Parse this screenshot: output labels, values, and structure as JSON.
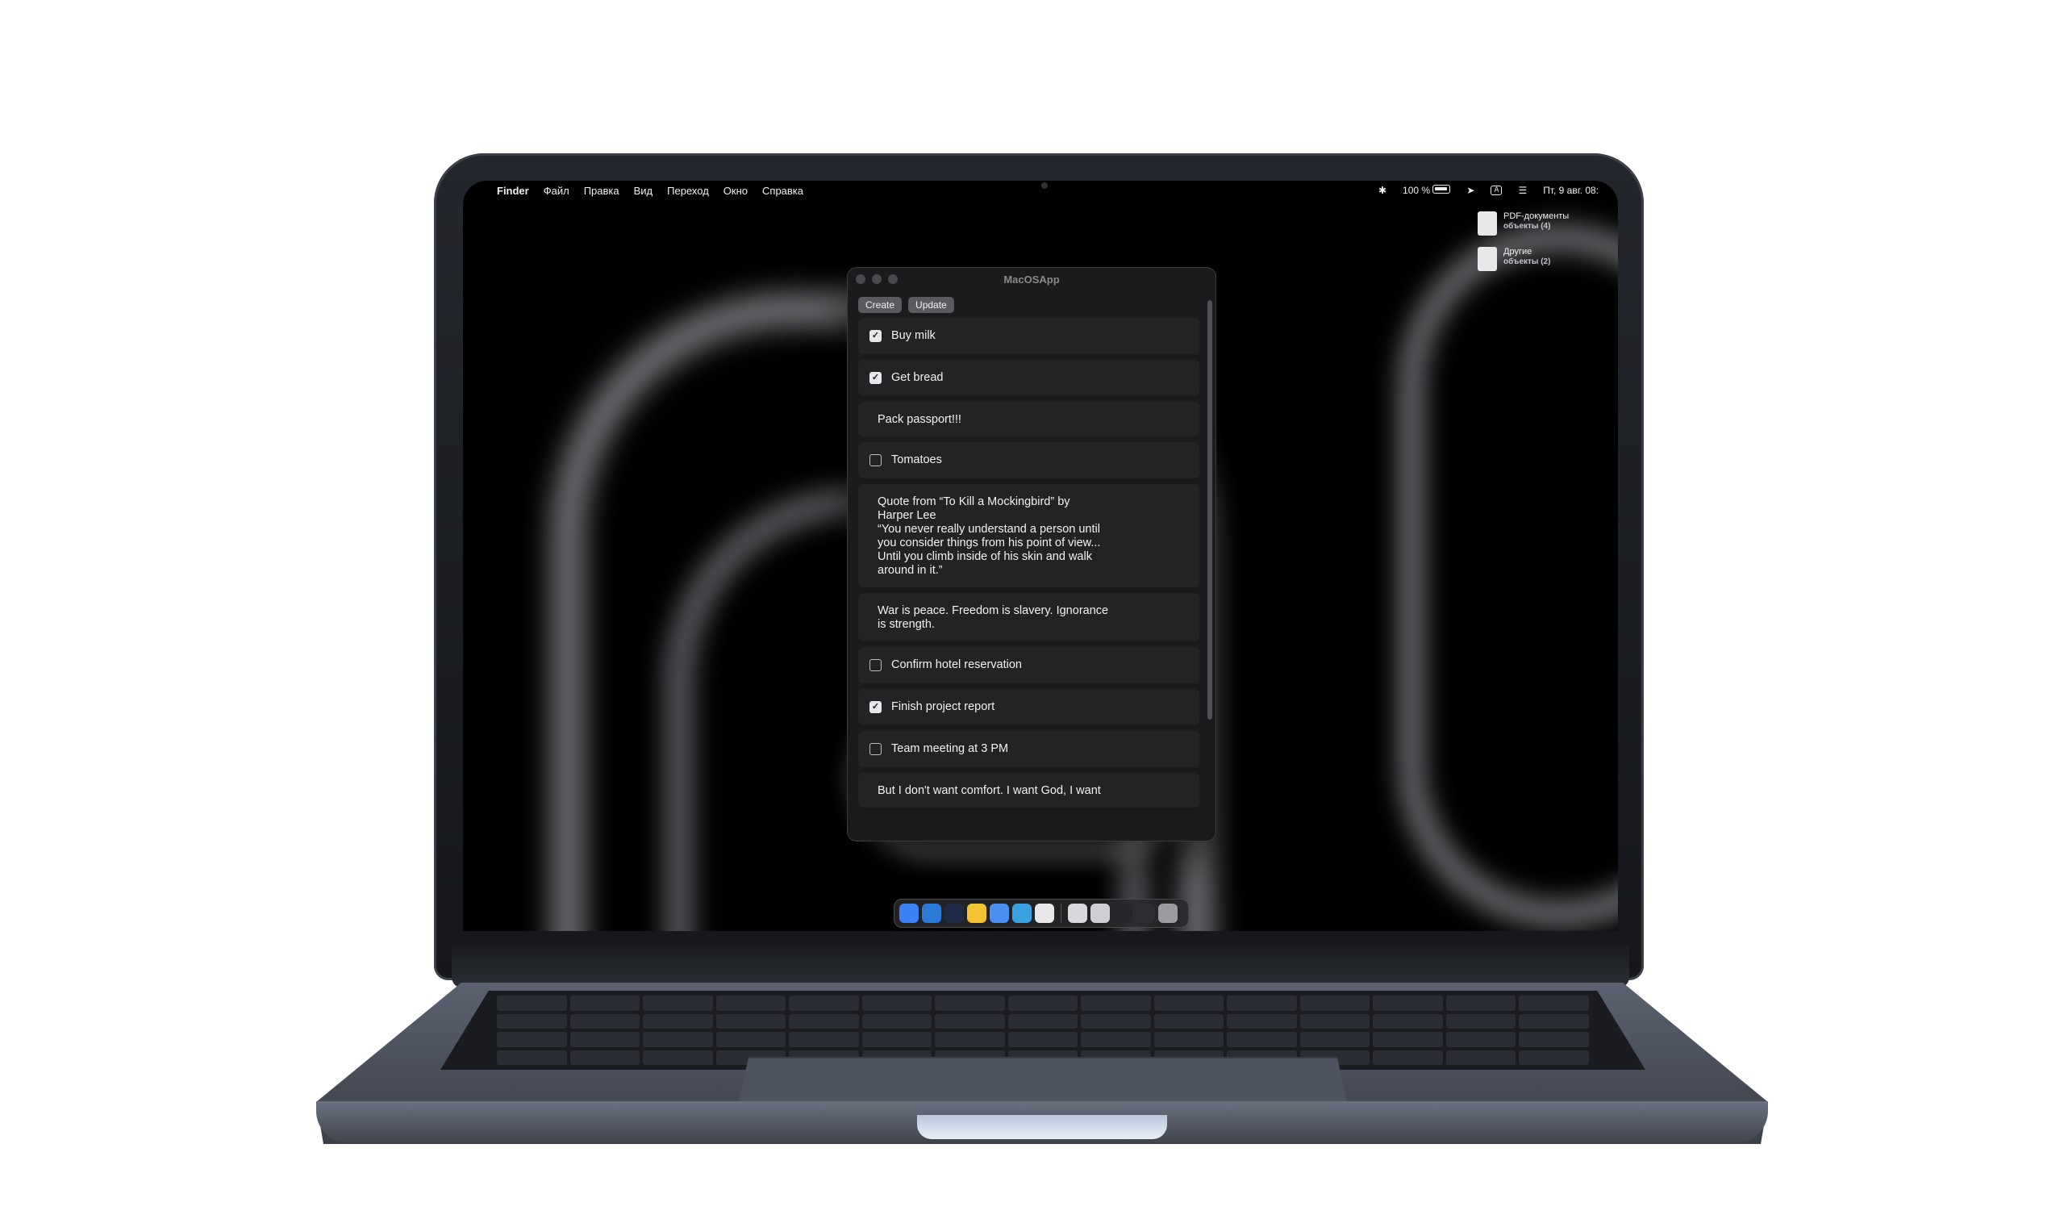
{
  "menubar": {
    "apple_icon": "apple-icon",
    "items": [
      "Finder",
      "Файл",
      "Правка",
      "Вид",
      "Переход",
      "Окно",
      "Справка"
    ],
    "battery_text": "100 %",
    "keyboard_layout": "A",
    "datetime": "Пт, 9 авг. 08:"
  },
  "desktop": {
    "items": [
      {
        "label": "PDF-документы",
        "sub": "объекты (4)",
        "icon": "pdf-stack-icon"
      },
      {
        "label": "Другие",
        "sub": "объекты (2)",
        "icon": "files-stack-icon"
      }
    ]
  },
  "window": {
    "title": "MacOSApp",
    "toolbar": {
      "create_label": "Create",
      "update_label": "Update"
    },
    "items": [
      {
        "type": "todo",
        "checked": true,
        "text": "Buy milk"
      },
      {
        "type": "todo",
        "checked": true,
        "text": "Get bread"
      },
      {
        "type": "note",
        "text": "Pack passport!!!"
      },
      {
        "type": "todo",
        "checked": false,
        "text": "Tomatoes"
      },
      {
        "type": "note",
        "text": "Quote from “To Kill a Mockingbird” by\nHarper Lee\n“You never really understand a person until\nyou consider things from his point of view...\nUntil you climb inside of his skin and walk\naround in it.”"
      },
      {
        "type": "note",
        "text": "War is peace. Freedom is slavery. Ignorance\nis strength."
      },
      {
        "type": "todo",
        "checked": false,
        "text": "Confirm hotel reservation"
      },
      {
        "type": "todo",
        "checked": true,
        "text": "Finish project report"
      },
      {
        "type": "todo",
        "checked": false,
        "text": "Team meeting at 3 PM"
      },
      {
        "type": "note",
        "text": "But I don't want comfort. I want God, I want"
      }
    ]
  },
  "dock": {
    "apps": [
      {
        "name": "finder-icon",
        "color": "#3b82f6"
      },
      {
        "name": "safari-icon",
        "color": "#2b7ad8"
      },
      {
        "name": "xcode-icon",
        "color": "#1f2a44"
      },
      {
        "name": "chrome-icon",
        "color": "#f2c230"
      },
      {
        "name": "xcode-blue-icon",
        "color": "#4a8ff0"
      },
      {
        "name": "telegram-icon",
        "color": "#3aa0e0"
      },
      {
        "name": "notes-icon",
        "color": "#e8e8ea"
      },
      {
        "name": "document-icon",
        "color": "#d8d8dc"
      },
      {
        "name": "document-2-icon",
        "color": "#cfcfd3"
      },
      {
        "name": "window-thumb-icon",
        "color": "#26262a"
      },
      {
        "name": "window-thumb-2-icon",
        "color": "#2e2e33"
      },
      {
        "name": "trash-icon",
        "color": "#9a9aa0"
      }
    ]
  }
}
